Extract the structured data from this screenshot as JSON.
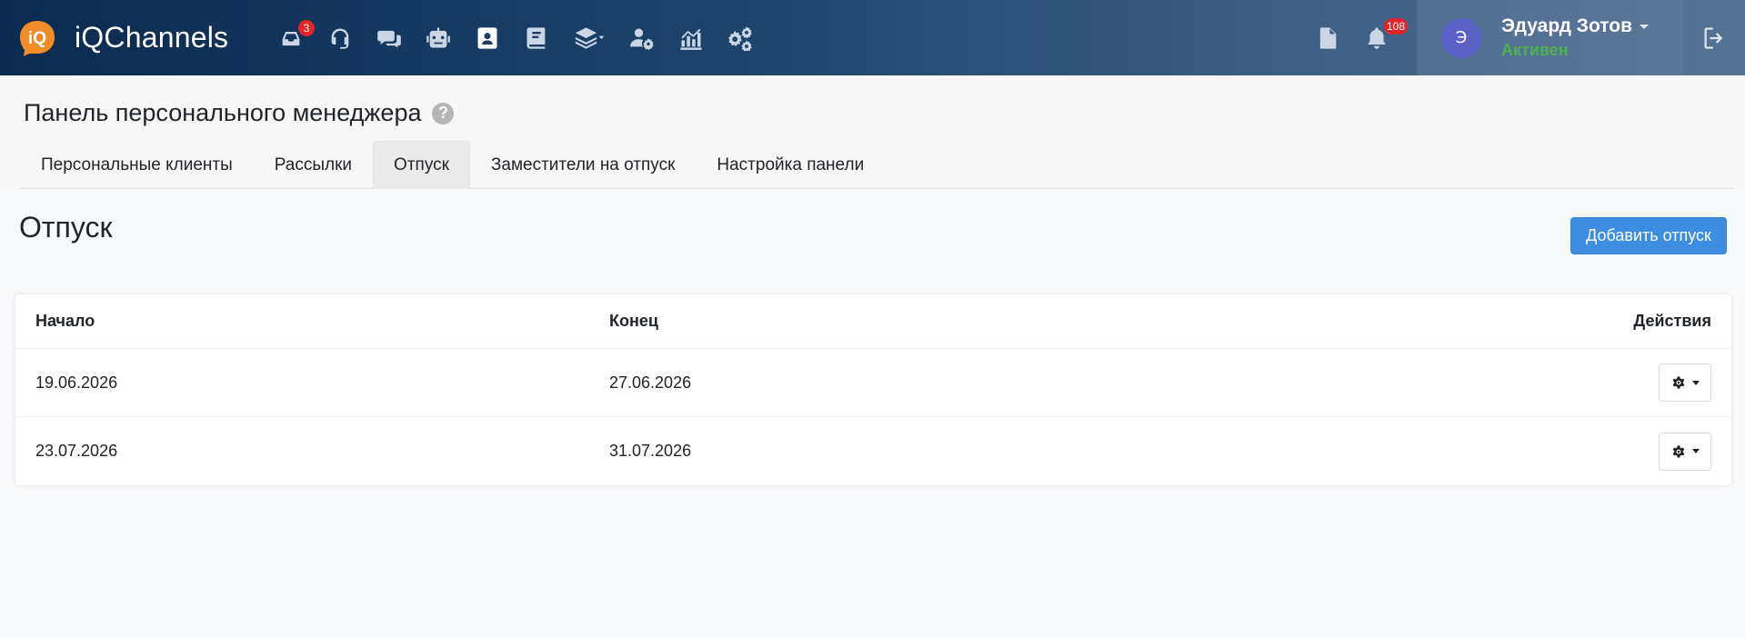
{
  "app": {
    "name": "iQChannels",
    "logo_text": "iQ",
    "brand_color": "#f28c28"
  },
  "navbar": {
    "icons": [
      {
        "name": "inbox-icon",
        "badge": "3"
      },
      {
        "name": "headset-icon"
      },
      {
        "name": "chat-icon"
      },
      {
        "name": "robot-icon"
      },
      {
        "name": "contacts-icon",
        "active": true
      },
      {
        "name": "book-icon"
      },
      {
        "name": "layers-icon"
      },
      {
        "name": "user-settings-icon"
      },
      {
        "name": "analytics-icon"
      },
      {
        "name": "settings-icon"
      }
    ],
    "notifications_badge": "108",
    "badge_color": "#e0262a"
  },
  "user": {
    "initial": "Э",
    "name": "Эдуард Зотов",
    "status": "Активен",
    "status_color": "#4caf50"
  },
  "page": {
    "title": "Панель персонального менеджера",
    "help": "?"
  },
  "tabs": [
    {
      "label": "Персональные клиенты"
    },
    {
      "label": "Рассылки"
    },
    {
      "label": "Отпуск",
      "active": true
    },
    {
      "label": "Заместители на отпуск"
    },
    {
      "label": "Настройка панели"
    }
  ],
  "section": {
    "title": "Отпуск",
    "add_button": "Добавить отпуск"
  },
  "table": {
    "headers": {
      "start": "Начало",
      "end": "Конец",
      "actions": "Действия"
    },
    "rows": [
      {
        "start": "19.06.2026",
        "end": "27.06.2026"
      },
      {
        "start": "23.07.2026",
        "end": "31.07.2026"
      }
    ]
  }
}
